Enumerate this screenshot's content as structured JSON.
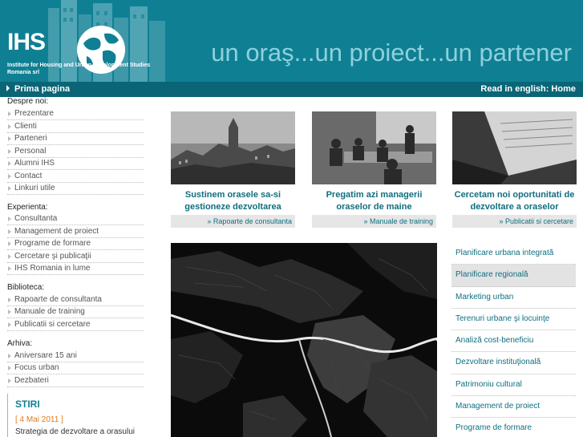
{
  "header": {
    "logo_text": "IHS",
    "logo_subtitle_1": "Institute for Housing and Urban Development Studies",
    "logo_subtitle_2": "Romania srl",
    "tagline": "un oraş...un proiect...un partener"
  },
  "navbar": {
    "home_label": "Prima pagina",
    "english_label": "Read in english: Home"
  },
  "sidebar": {
    "sections": [
      {
        "title": "Despre noi:",
        "items": [
          "Prezentare",
          "Clienti",
          "Parteneri",
          "Personal",
          "Alumni IHS",
          "Contact",
          "Linkuri utile"
        ]
      },
      {
        "title": "Experienta:",
        "items": [
          "Consultanta",
          "Management de proiect",
          "Programe de formare",
          "Cercetare şi publicaţii",
          "IHS Romania in lume"
        ]
      },
      {
        "title": "Biblioteca:",
        "items": [
          "Rapoarte de consultanta",
          "Manuale de training",
          "Publicatii si cercetare"
        ]
      },
      {
        "title": "Arhiva:",
        "items": [
          "Aniversare 15 ani",
          "Focus urban",
          "Dezbateri"
        ]
      }
    ],
    "news": {
      "title": "STIRI",
      "date": "[ 4 Mai 2011 ]",
      "text": "Strategia de dezvoltare a orasului"
    }
  },
  "cards": [
    {
      "caption_1": "Sustinem orasele sa-si",
      "caption_2": "gestioneze dezvoltarea",
      "link": "» Rapoarte de consultanta",
      "icon": "town-photo"
    },
    {
      "caption_1": "Pregatim azi managerii",
      "caption_2": "oraselor de maine",
      "link": "» Manuale de training",
      "icon": "classroom-photo"
    },
    {
      "caption_1": "Cercetam noi oportunitati de",
      "caption_2": "dezvoltare a oraselor",
      "link": "» Publicatii si cercetare",
      "icon": "laptop-photo"
    }
  ],
  "right_menu": {
    "items": [
      "Planificare urbana integrată",
      "Planificare regională",
      "Marketing urban",
      "Terenuri urbane şi locuinţe",
      "Analiză cost-beneficiu",
      "Dezvoltare instituţională",
      "Patrimoniu cultural",
      "Management de proiect",
      "Programe de formare"
    ],
    "active_index": 1
  },
  "colors": {
    "header_bg": "#0f8093",
    "navbar_bg": "#0a6576",
    "accent_text": "#0f6f80",
    "news_date": "#e07b1a"
  }
}
